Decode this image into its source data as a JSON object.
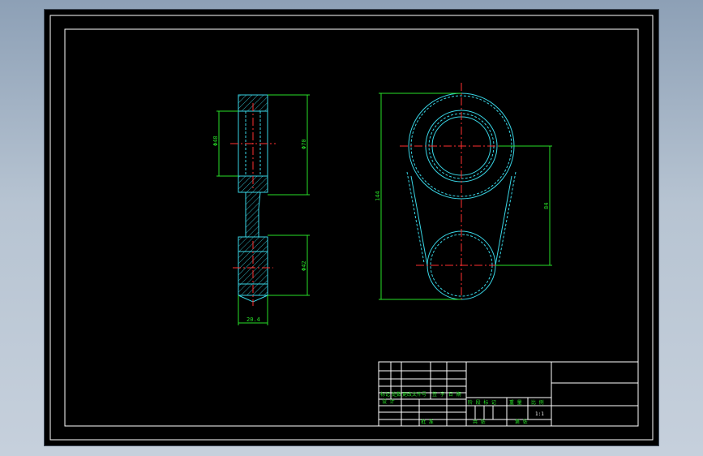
{
  "drawing": {
    "dimensions": {
      "inner_bore_diameter": "Φ48",
      "outer_diameter": "Φ70",
      "small_bore_diameter": "Φ42",
      "thickness": "20.4",
      "overall_length": "144",
      "center_distance": "84"
    },
    "title_block": {
      "row_labels": [
        "标记",
        "处数",
        "更改文件号",
        "签 字",
        "日 期"
      ],
      "design_label": "设 计",
      "stage_headers": [
        "阶 段 标 记",
        "重 量",
        "比 例"
      ],
      "scale": "1:1",
      "approve_label": "批 准",
      "sheet_labels": [
        "共 张",
        "第 张"
      ]
    }
  },
  "colors": {
    "background": "#000000",
    "frame": "#ffffff",
    "geometry": "#39d6e6",
    "dimension": "#28e028",
    "centerline": "#ff3030"
  }
}
